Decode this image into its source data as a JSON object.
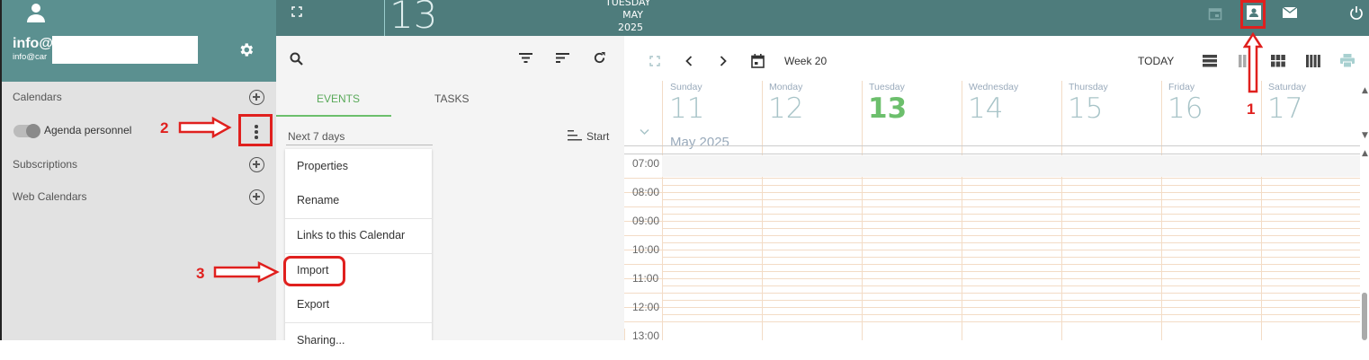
{
  "user": {
    "name": "info@",
    "email": "info@car"
  },
  "header": {
    "weekday": "TUESDAY",
    "month": "MAY",
    "year": "2025",
    "day": "13"
  },
  "sidebar": {
    "calendars_label": "Calendars",
    "calendar_item": "Agenda personnel",
    "subscriptions_label": "Subscriptions",
    "web_calendars_label": "Web Calendars"
  },
  "list": {
    "tabs": [
      "EVENTS",
      "TASKS"
    ],
    "filter": "Next 7 days",
    "sort": "Start"
  },
  "context_menu": [
    "Properties",
    "Rename",
    "Links to this Calendar",
    "Import",
    "Export",
    "Sharing..."
  ],
  "calendar": {
    "week_label": "Week 20",
    "today_label": "TODAY",
    "month_year": "May 2025",
    "days": [
      {
        "name": "Sunday",
        "num": "11"
      },
      {
        "name": "Monday",
        "num": "12"
      },
      {
        "name": "Tuesday",
        "num": "13"
      },
      {
        "name": "Wednesday",
        "num": "14"
      },
      {
        "name": "Thursday",
        "num": "15"
      },
      {
        "name": "Friday",
        "num": "16"
      },
      {
        "name": "Saturday",
        "num": "17"
      }
    ],
    "hours": [
      "07:00",
      "08:00",
      "09:00",
      "10:00",
      "11:00",
      "12:00",
      "13:00"
    ]
  },
  "annotations": [
    "1",
    "2",
    "3"
  ],
  "colors": {
    "header": "#4e7c7c",
    "sidebar_head": "#5b9090",
    "accent_green": "#6cbf6c",
    "annotation_red": "#e0201e"
  }
}
